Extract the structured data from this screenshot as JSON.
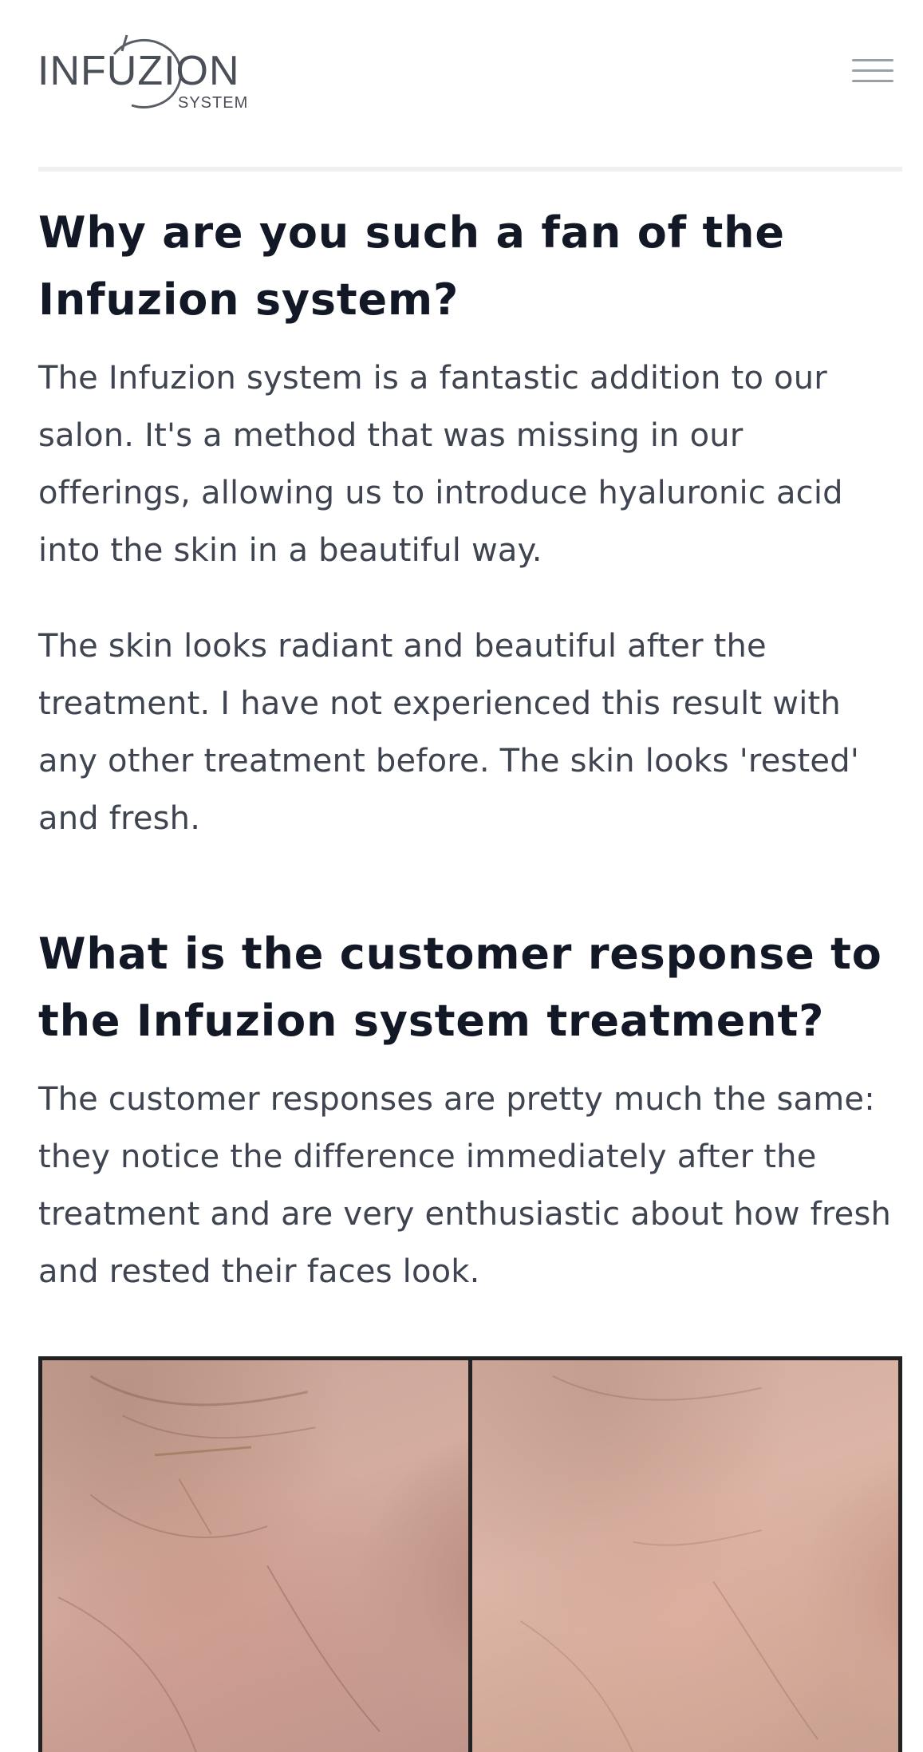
{
  "header": {
    "logo": {
      "wordmark": "INFUZION",
      "subtitle": "SYSTEM"
    },
    "menu_icon": "hamburger-menu-icon"
  },
  "content": {
    "section_1": {
      "title": "Why are you such a fan of the Infuzion system?",
      "paragraphs": [
        "The Infuzion system is a fantastic addition to our salon. It's a method that was missing in our offerings, allowing us to introduce hyaluronic acid into the skin in a beautiful way.",
        "The skin looks radiant and beautiful after the treatment. I have not experienced this result with any other treatment before. The skin looks 'rested' and fresh."
      ]
    },
    "section_2": {
      "title": "What is the customer response to the Infuzion system treatment?",
      "paragraphs": [
        "The customer responses are pretty much the same: they notice the difference immediately after the treatment and are very enthusiastic about how fresh and rested their faces look."
      ]
    }
  },
  "colors": {
    "heading": "#131826",
    "body_text": "#3f4451",
    "divider": "#eef0f2",
    "menu_icon": "#9aa0a8",
    "photo_border": "#222222"
  }
}
